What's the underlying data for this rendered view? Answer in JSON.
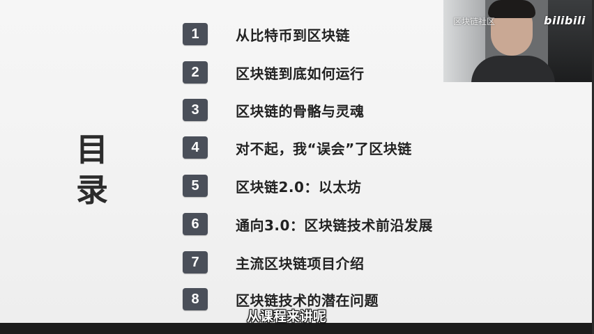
{
  "slide": {
    "title_chars": [
      "目",
      "录"
    ],
    "items": [
      {
        "number": "1",
        "label": "从比特币到区块链"
      },
      {
        "number": "2",
        "label": "区块链到底如何运行"
      },
      {
        "number": "3",
        "label": "区块链的骨骼与灵魂"
      },
      {
        "number": "4",
        "label": "对不起，我“误会”了区块链"
      },
      {
        "number": "5",
        "label": "区块链2.0：以太坊"
      },
      {
        "number": "6",
        "label": "通向3.0：区块链技术前沿发展"
      },
      {
        "number": "7",
        "label": "主流区块链项目介绍"
      },
      {
        "number": "8",
        "label": "区块链技术的潜在问题"
      }
    ]
  },
  "overlay": {
    "watermark": "区块链社区",
    "logo": "bilibili",
    "subtitle": "从课程来讲呢"
  },
  "colors": {
    "badge_bg": "#4a4f59",
    "badge_text": "#ffffff",
    "slide_bg": "#f4f4f4",
    "text": "#222222"
  }
}
